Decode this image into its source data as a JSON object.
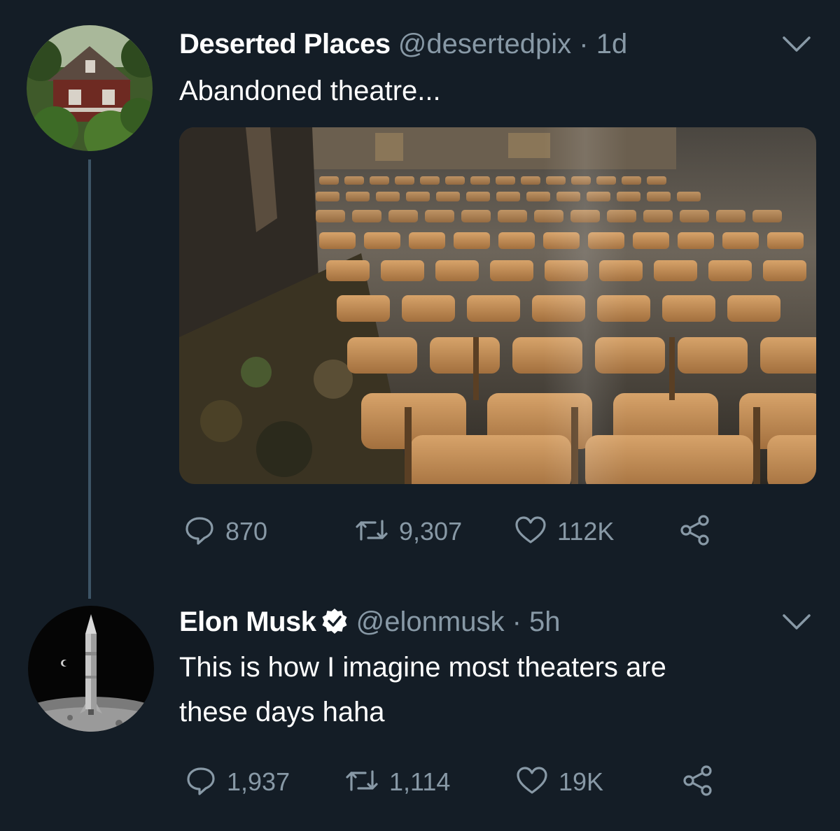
{
  "tweets": [
    {
      "name": "Deserted Places",
      "handle": "@desertedpix",
      "time": "1d",
      "separator": "·",
      "text": "Abandoned theatre...",
      "avatar_icon": "abandoned-house-photo",
      "media_icon": "abandoned-theatre-photo",
      "stats": {
        "replies": "870",
        "retweets": "9,307",
        "likes": "112K"
      }
    },
    {
      "name": "Elon Musk",
      "verified": true,
      "handle": "@elonmusk",
      "time": "5h",
      "separator": "·",
      "text_line1": "This is how I imagine most theaters are",
      "text_line2": "these days haha",
      "avatar_icon": "starship-on-moon-photo",
      "stats": {
        "replies": "1,937",
        "retweets": "1,114",
        "likes": "19K"
      }
    }
  ],
  "colors": {
    "background": "#141d26",
    "muted": "#8899a6",
    "thread_line": "#3d5466"
  }
}
